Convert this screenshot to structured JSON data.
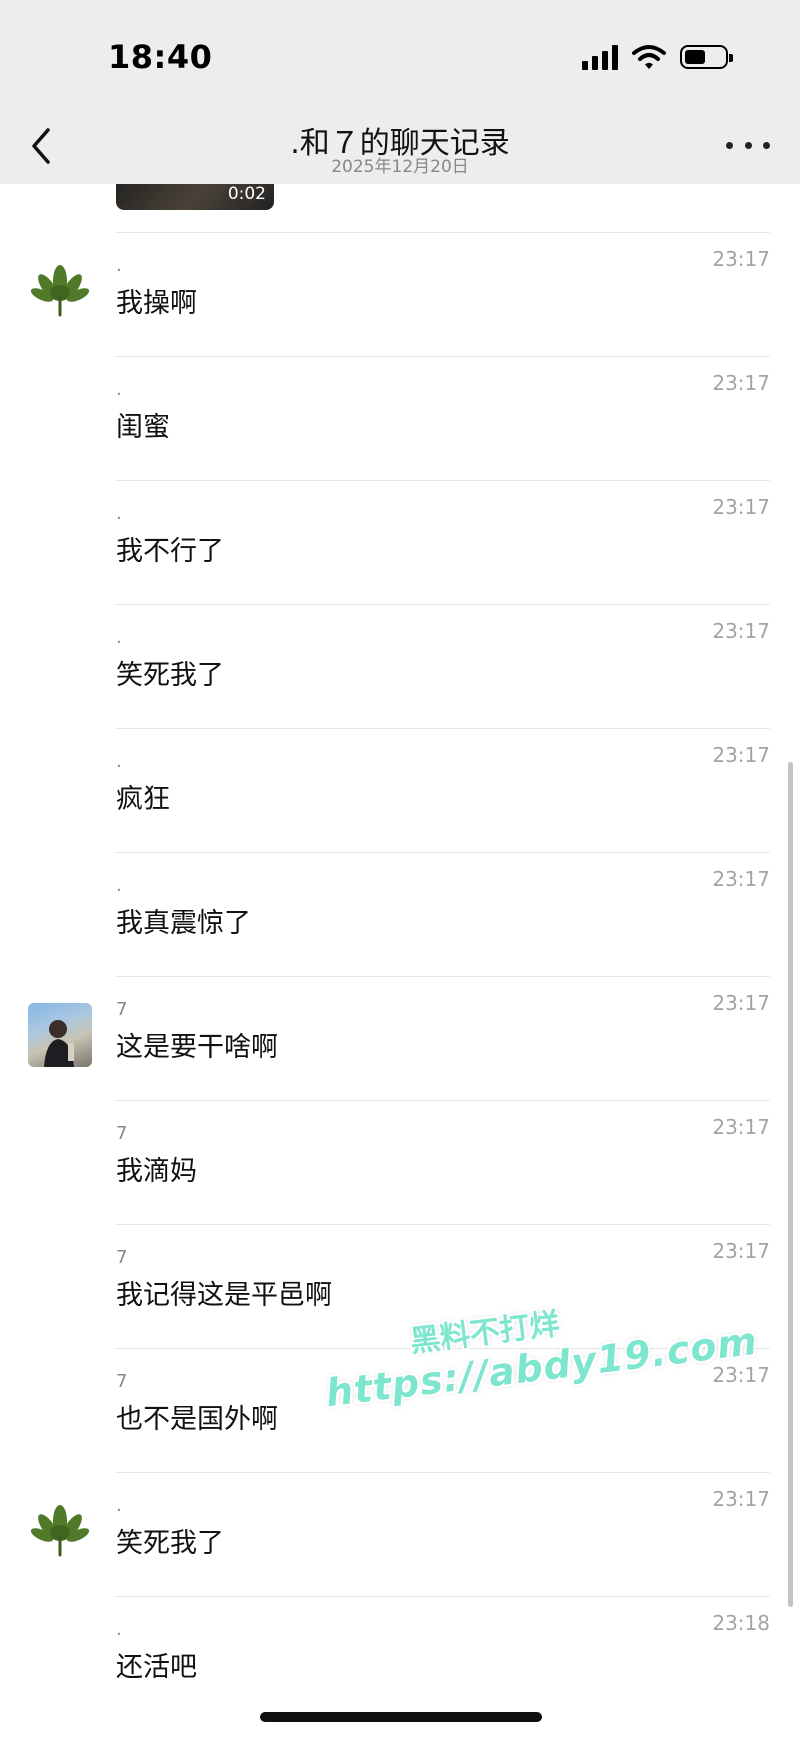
{
  "status_bar": {
    "time": "18:40"
  },
  "nav": {
    "title": ".和７的聊天记录",
    "subtitle": "2025年12月20日"
  },
  "video": {
    "duration": "0:02"
  },
  "messages": [
    {
      "sender": ".",
      "time": "23:17",
      "text": "我操啊",
      "avatar": "leaf"
    },
    {
      "sender": ".",
      "time": "23:17",
      "text": "闺蜜",
      "avatar": ""
    },
    {
      "sender": ".",
      "time": "23:17",
      "text": "我不行了",
      "avatar": ""
    },
    {
      "sender": ".",
      "time": "23:17",
      "text": "笑死我了",
      "avatar": ""
    },
    {
      "sender": ".",
      "time": "23:17",
      "text": "疯狂",
      "avatar": ""
    },
    {
      "sender": ".",
      "time": "23:17",
      "text": "我真震惊了",
      "avatar": ""
    },
    {
      "sender": "7",
      "time": "23:17",
      "text": "这是要干啥啊",
      "avatar": "photo"
    },
    {
      "sender": "7",
      "time": "23:17",
      "text": "我滴妈",
      "avatar": ""
    },
    {
      "sender": "7",
      "time": "23:17",
      "text": "我记得这是平邑啊",
      "avatar": ""
    },
    {
      "sender": "7",
      "time": "23:17",
      "text": "也不是国外啊",
      "avatar": ""
    },
    {
      "sender": ".",
      "time": "23:17",
      "text": "笑死我了",
      "avatar": "leaf"
    },
    {
      "sender": ".",
      "time": "23:18",
      "text": "还活吧",
      "avatar": ""
    }
  ],
  "watermark": {
    "line1": "黑料不打烊",
    "line2": "https://abdy19.com"
  }
}
